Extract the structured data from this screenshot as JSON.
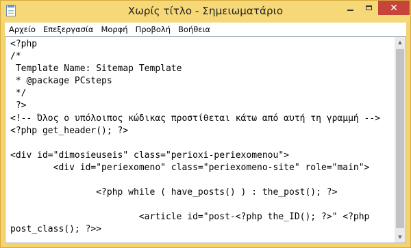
{
  "window": {
    "title": "Χωρίς τίτλο - Σημειωματάριο",
    "close_glyph": "✕"
  },
  "menu": {
    "items": [
      "Αρχείο",
      "Επεξεργασία",
      "Μορφή",
      "Προβολή",
      "Βοήθεια"
    ]
  },
  "editor": {
    "content": "<?php\n/*\n Template Name: Sitemap Template\n * @package PCsteps\n */\n ?>\n<!-- Όλος ο υπόλοιπος κώδικας προστίθεται κάτω από αυτή τη γραμμή -->\n<?php get_header(); ?>\n\n<div id=\"dimosieuseis\" class=\"perioxi-periexomenou\">\n        <div id=\"periexomeno\" class=\"periexomeno-site\" role=\"main\">\n\n                <?php while ( have_posts() ) : the_post(); ?>\n\n                        <article id=\"post-<?php the_ID(); ?>\" <?php\npost_class(); ?>>"
  },
  "icons": {
    "app": "notepad-icon",
    "minimize": "minimize-icon",
    "maximize": "maximize-icon",
    "close": "close-icon",
    "scroll_up": "scroll-up-arrow-icon",
    "scroll_down": "scroll-down-arrow-icon"
  },
  "colors": {
    "titlebar": "#f7d878",
    "close_button": "#c7443a",
    "editor_bg": "#ffffff",
    "scrollbar_track": "#eaeaea",
    "scrollbar_thumb": "#c2c2c2"
  }
}
